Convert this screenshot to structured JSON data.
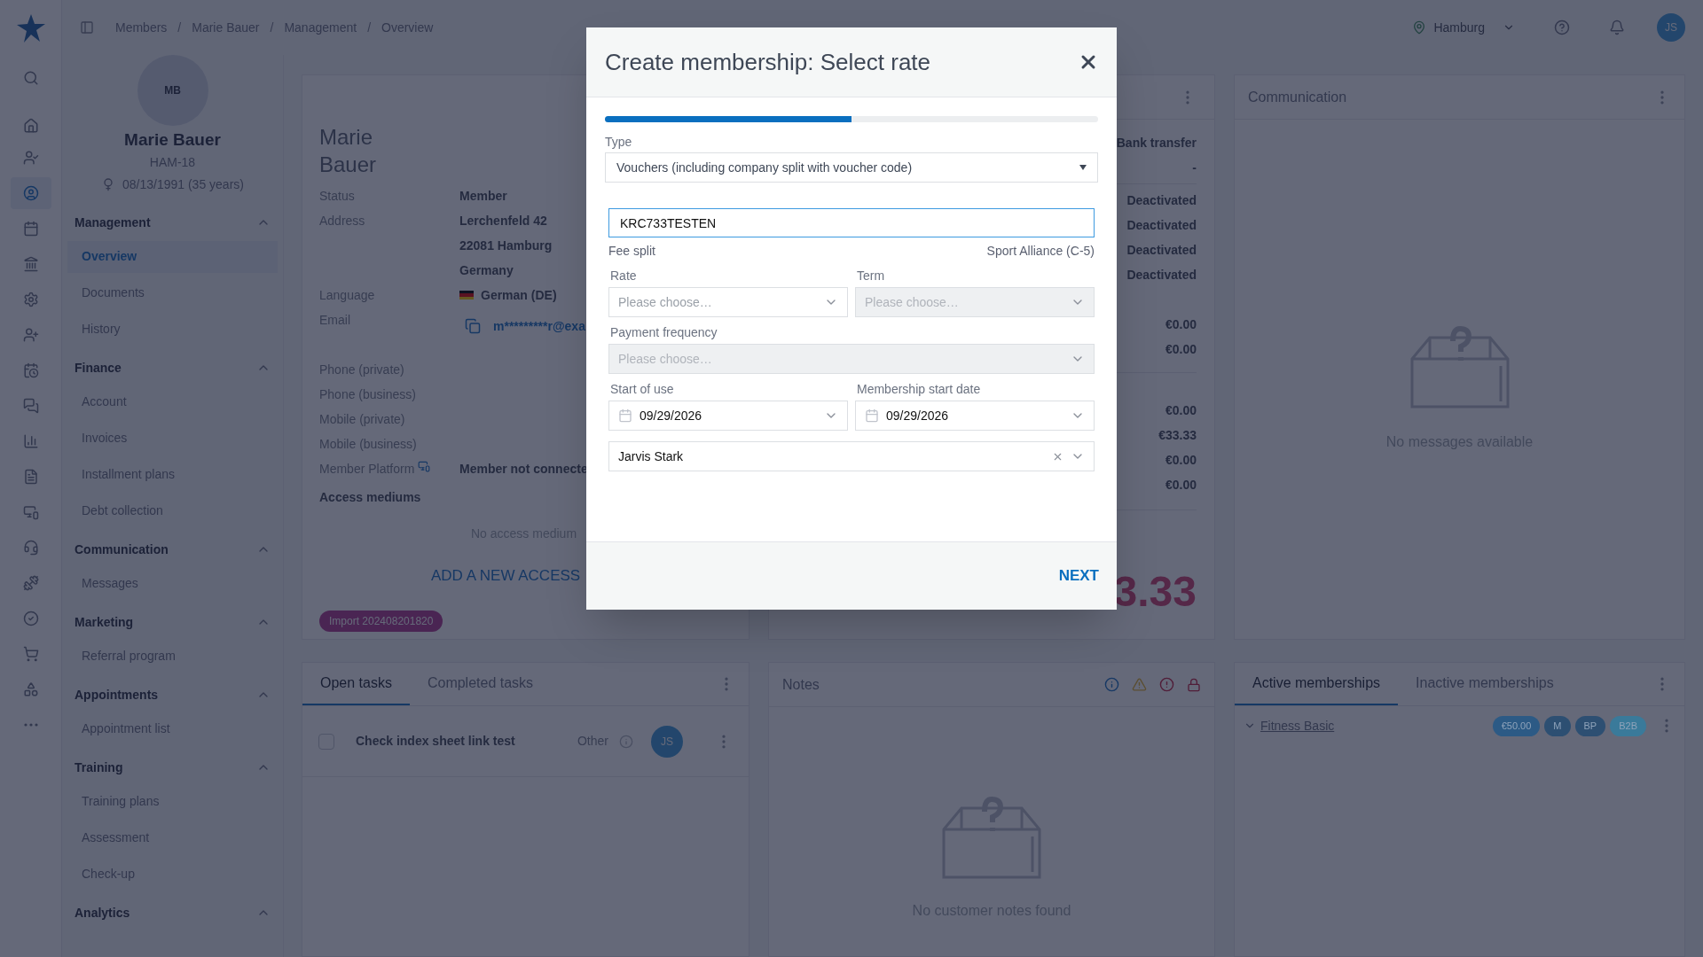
{
  "top_bar": {
    "breadcrumbs": [
      "Members",
      "Marie Bauer",
      "Management",
      "Overview"
    ],
    "separator": "/",
    "location": "Hamburg",
    "user_initials": "JS"
  },
  "rail": [
    {
      "selected": false
    },
    {
      "selected": false
    },
    {
      "selected": false
    },
    {
      "selected": true
    },
    {
      "selected": false
    },
    {
      "selected": false
    },
    {
      "selected": false
    },
    {
      "selected": false
    },
    {
      "selected": false
    },
    {
      "selected": false
    },
    {
      "selected": false
    },
    {
      "selected": false
    },
    {
      "selected": false
    },
    {
      "selected": false
    },
    {
      "selected": false
    },
    {
      "selected": false
    },
    {
      "selected": false
    },
    {
      "selected": false
    },
    {
      "selected": false
    }
  ],
  "member": {
    "initials": "MB",
    "name": "Marie Bauer",
    "id": "HAM-18",
    "birth": "08/13/1991 (35 years)"
  },
  "nav": [
    {
      "title": "Management",
      "expanded": true,
      "items": [
        {
          "label": "Overview",
          "selected": true
        },
        {
          "label": "Documents",
          "selected": false
        },
        {
          "label": "History",
          "selected": false
        }
      ]
    },
    {
      "title": "Finance",
      "expanded": true,
      "items": [
        {
          "label": "Account",
          "selected": false
        },
        {
          "label": "Invoices",
          "selected": false
        },
        {
          "label": "Installment plans",
          "selected": false
        },
        {
          "label": "Debt collection",
          "selected": false
        }
      ]
    },
    {
      "title": "Communication",
      "expanded": true,
      "items": [
        {
          "label": "Messages",
          "selected": false
        }
      ]
    },
    {
      "title": "Marketing",
      "expanded": true,
      "items": [
        {
          "label": "Referral program",
          "selected": false
        }
      ]
    },
    {
      "title": "Appointments",
      "expanded": true,
      "items": [
        {
          "label": "Appointment list",
          "selected": false
        }
      ]
    },
    {
      "title": "Training",
      "expanded": true,
      "items": [
        {
          "label": "Training plans",
          "selected": false
        },
        {
          "label": "Assessment",
          "selected": false
        },
        {
          "label": "Check-up",
          "selected": false
        }
      ]
    },
    {
      "title": "Analytics",
      "expanded": true
    }
  ],
  "profile_card": {
    "name_lines": [
      "Marie",
      "Bauer"
    ],
    "fields": [
      {
        "label": "Status",
        "kind": "text",
        "values": [
          "Member"
        ]
      },
      {
        "label": "Address",
        "kind": "text",
        "values": [
          "Lerchenfeld 42",
          "22081 Hamburg",
          "Germany"
        ]
      },
      {
        "label": "Language",
        "kind": "language",
        "values": [
          "German (DE)"
        ]
      },
      {
        "label": "Email",
        "kind": "email",
        "values": [
          "m*********r@exa"
        ]
      },
      {
        "label": "Phone (private)",
        "kind": "text"
      },
      {
        "label": "Phone (business)",
        "kind": "text"
      },
      {
        "label": "Mobile (private)",
        "kind": "text"
      },
      {
        "label": "Mobile (business)",
        "kind": "text"
      },
      {
        "label": "Member Platform",
        "kind": "platform",
        "values": [
          "Member not connecte"
        ]
      }
    ],
    "access_heading": "Access mediums",
    "empty_text": "No access medium",
    "add_link": "ADD A NEW ACCESS",
    "tag": "Import 202408201820"
  },
  "finance_card": {
    "groups": [
      [
        "Bank transfer",
        "-"
      ],
      [
        "Deactivated",
        "Deactivated",
        "Deactivated",
        "Deactivated",
        "€0.00",
        "€0.00"
      ],
      [
        "€0.00",
        "€33.33",
        "€0.00",
        "€0.00"
      ]
    ],
    "big_amount": "3.33"
  },
  "communication_card": {
    "title": "Communication",
    "empty_text": "No messages available"
  },
  "tasks_card": {
    "tabs": [
      {
        "label": "Open tasks",
        "selected": true
      },
      {
        "label": "Completed tasks",
        "selected": false
      }
    ],
    "rows": [
      {
        "checked": false,
        "title": "Check index sheet link test",
        "category": "Other",
        "assignee": "JS"
      }
    ]
  },
  "notes_card": {
    "title": "Notes",
    "empty_text": "No customer notes found"
  },
  "memberships_card": {
    "tabs": [
      {
        "label": "Active memberships",
        "selected": true
      },
      {
        "label": "Inactive memberships",
        "selected": false
      }
    ],
    "rows": [
      {
        "name": "Fitness Basic",
        "expanded": false,
        "badges": [
          {
            "text": "€50.00",
            "color": "#2c5a85"
          },
          {
            "text": "M",
            "color": "#2d4f72"
          },
          {
            "text": "BP",
            "color": "#2d4f72"
          },
          {
            "text": "B2B",
            "color": "#3a7a9a"
          }
        ]
      }
    ]
  },
  "dialog": {
    "title": "Create membership: Select rate",
    "progress": {
      "level": 0.5
    },
    "type": {
      "label": "Type",
      "value": "Vouchers (including company split with voucher code)"
    },
    "voucher": {
      "value": "KRC733TESTEN",
      "focused": true
    },
    "fee_split": {
      "label": "Fee split",
      "value": "Sport Alliance (C-5)"
    },
    "rows": [
      [
        {
          "label": "Rate",
          "kind": "select",
          "placeholder": "Please choose…",
          "disabled": false
        },
        {
          "label": "Term",
          "kind": "select",
          "placeholder": "Please choose…",
          "disabled": true
        }
      ],
      [
        {
          "label": "Payment frequency",
          "kind": "select",
          "placeholder": "Please choose…",
          "disabled": true
        }
      ],
      [
        {
          "label": "Start of use",
          "kind": "date",
          "value": "09/29/2026",
          "disabled": false
        },
        {
          "label": "Membership start date",
          "kind": "date",
          "value": "09/29/2026",
          "disabled": false
        }
      ]
    ],
    "trainer": {
      "value": "Jarvis Stark"
    },
    "next": "NEXT"
  }
}
